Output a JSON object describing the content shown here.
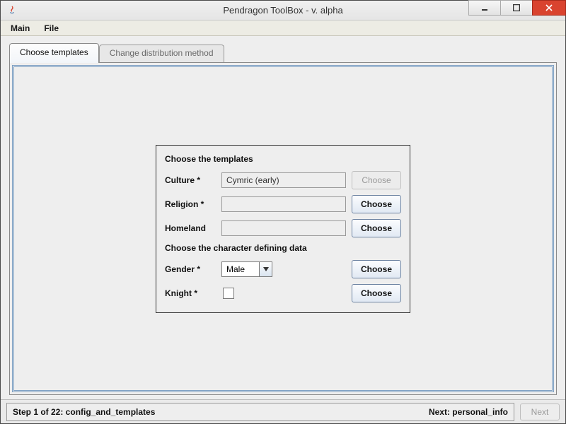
{
  "window": {
    "title": "Pendragon ToolBox - v. alpha"
  },
  "menu": {
    "main": "Main",
    "file": "File"
  },
  "tabs": {
    "choose_templates": "Choose templates",
    "change_distribution": "Change distribution method"
  },
  "form": {
    "section1": "Choose the templates",
    "culture_label": "Culture *",
    "culture_value": "Cymric (early)",
    "culture_choose": "Choose",
    "religion_label": "Religion *",
    "religion_value": "",
    "religion_choose": "Choose",
    "homeland_label": "Homeland",
    "homeland_value": "",
    "homeland_choose": "Choose",
    "section2": "Choose the character defining data",
    "gender_label": "Gender *",
    "gender_value": "Male",
    "gender_choose": "Choose",
    "knight_label": "Knight *",
    "knight_choose": "Choose"
  },
  "status": {
    "step": "Step 1 of 22: config_and_templates",
    "next_label": "Next: personal_info",
    "next_button": "Next"
  }
}
